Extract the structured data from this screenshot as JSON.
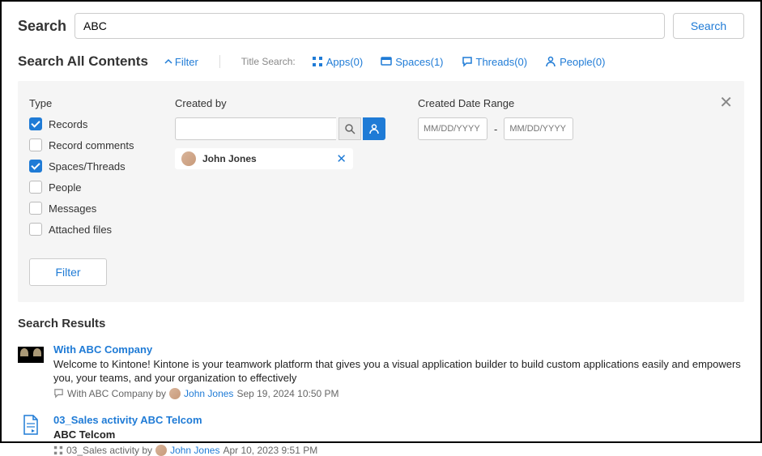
{
  "search": {
    "label": "Search",
    "value": "ABC",
    "button": "Search"
  },
  "subheader": {
    "title": "Search All Contents",
    "filter_toggle": "Filter",
    "title_search_label": "Title Search:",
    "tabs": {
      "apps": "Apps(0)",
      "spaces": "Spaces(1)",
      "threads": "Threads(0)",
      "people": "People(0)"
    }
  },
  "filter": {
    "type_label": "Type",
    "types": [
      {
        "label": "Records",
        "checked": true
      },
      {
        "label": "Record comments",
        "checked": false
      },
      {
        "label": "Spaces/Threads",
        "checked": true
      },
      {
        "label": "People",
        "checked": false
      },
      {
        "label": "Messages",
        "checked": false
      },
      {
        "label": "Attached files",
        "checked": false
      }
    ],
    "created_by_label": "Created by",
    "chip_user": "John Jones",
    "date_label": "Created Date Range",
    "date_placeholder": "MM/DD/YYYY",
    "divider": "-",
    "apply": "Filter"
  },
  "results": {
    "heading": "Search Results",
    "items": [
      {
        "title": "With ABC Company",
        "body": "Welcome to Kintone! Kintone is your teamwork platform that gives you a visual application builder to build custom applications easily and empowers you, your teams, and your organization to effectively",
        "meta_prefix": "With ABC Company by",
        "author": "John Jones",
        "date": "Sep 19, 2024 10:50 PM"
      },
      {
        "title": "03_Sales activity ABC Telcom",
        "body": "ABC Telcom",
        "meta_prefix": "03_Sales activity by",
        "author": "John Jones",
        "date": "Apr 10, 2023 9:51 PM"
      }
    ]
  }
}
